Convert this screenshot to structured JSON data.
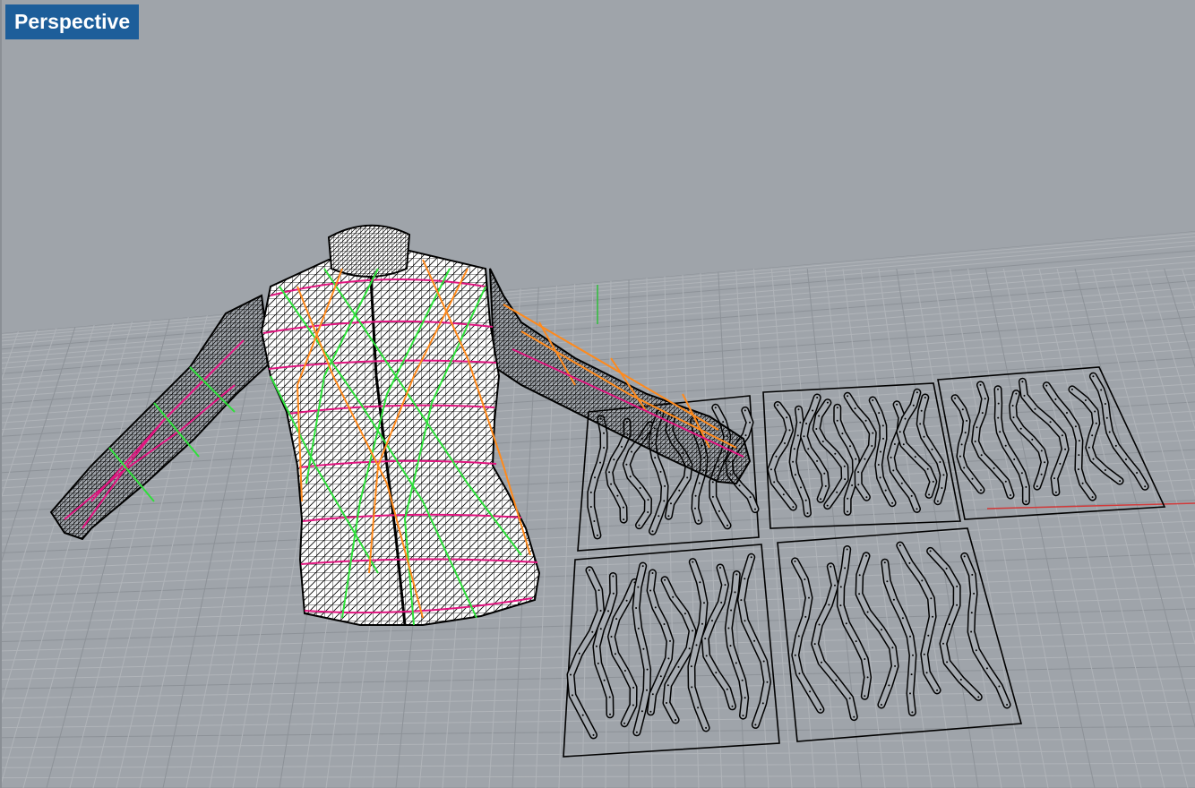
{
  "viewport": {
    "label": "Perspective"
  },
  "scene": {
    "grid": true,
    "colors": {
      "background": "#9fa4aa",
      "grid_minor": "#b0b4b9",
      "grid_major": "#8d9298",
      "axis_x": "#d23a3a",
      "axis_y": "#2fbf3a",
      "mesh": "#000000",
      "garment_fill": "#ffffff",
      "seam_magenta": "#e0157f",
      "seam_green": "#2ee03a",
      "seam_orange": "#ff8a1c",
      "tab_background": "#1d5e9a",
      "tab_text": "#ffffff"
    },
    "objects": [
      "mesh-garment",
      "pattern-sheet-1",
      "pattern-sheet-2",
      "pattern-sheet-3",
      "pattern-sheet-4",
      "pattern-sheet-5"
    ]
  }
}
